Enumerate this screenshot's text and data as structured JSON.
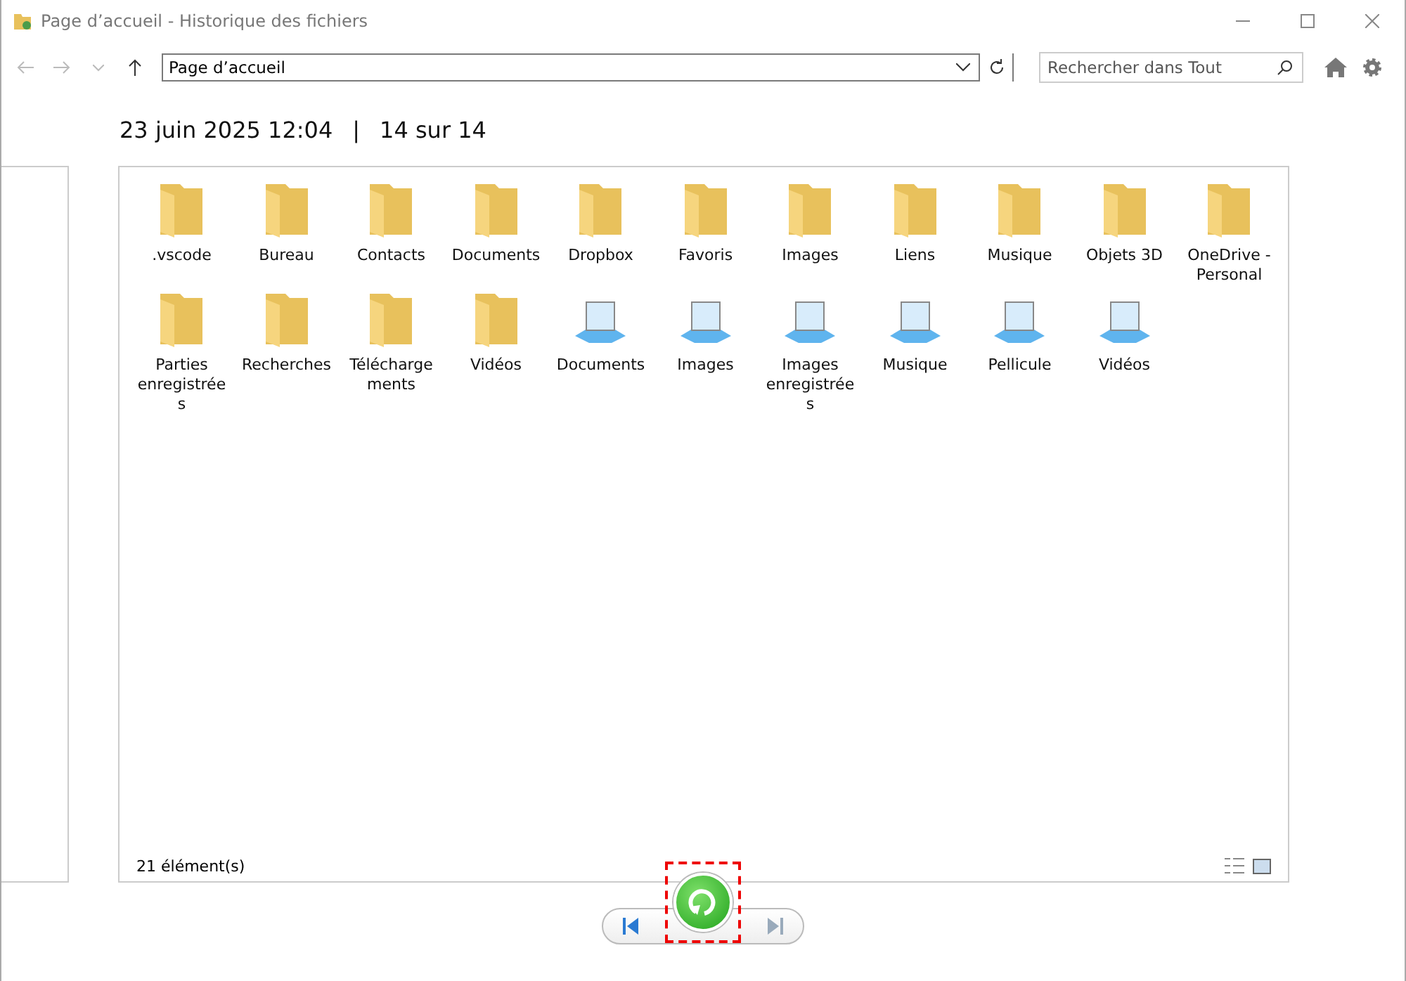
{
  "window": {
    "title": "Page d’accueil - Historique des fichiers"
  },
  "address": {
    "value": "Page d’accueil"
  },
  "search": {
    "placeholder": "Rechercher dans Tout"
  },
  "header": {
    "date": "23 juin 2025 12:04",
    "separator": "|",
    "position": "14 sur 14"
  },
  "items": [
    {
      "label": ".vscode",
      "kind": "folder"
    },
    {
      "label": "Bureau",
      "kind": "folder"
    },
    {
      "label": "Contacts",
      "kind": "folder"
    },
    {
      "label": "Documents",
      "kind": "folder"
    },
    {
      "label": "Dropbox",
      "kind": "folder"
    },
    {
      "label": "Favoris",
      "kind": "folder"
    },
    {
      "label": "Images",
      "kind": "folder"
    },
    {
      "label": "Liens",
      "kind": "folder"
    },
    {
      "label": "Musique",
      "kind": "folder"
    },
    {
      "label": "Objets 3D",
      "kind": "folder"
    },
    {
      "label": "OneDrive - Personal",
      "kind": "folder"
    },
    {
      "label": "Parties enregistrée s",
      "kind": "folder"
    },
    {
      "label": "Recherches",
      "kind": "folder"
    },
    {
      "label": "Télécharge ments",
      "kind": "folder"
    },
    {
      "label": "Vidéos",
      "kind": "folder"
    },
    {
      "label": "Documents",
      "kind": "library"
    },
    {
      "label": "Images",
      "kind": "library"
    },
    {
      "label": "Images enregistrée s",
      "kind": "library"
    },
    {
      "label": "Musique",
      "kind": "library"
    },
    {
      "label": "Pellicule",
      "kind": "library"
    },
    {
      "label": "Vidéos",
      "kind": "library"
    }
  ],
  "status": {
    "count": "21 élément(s)"
  }
}
